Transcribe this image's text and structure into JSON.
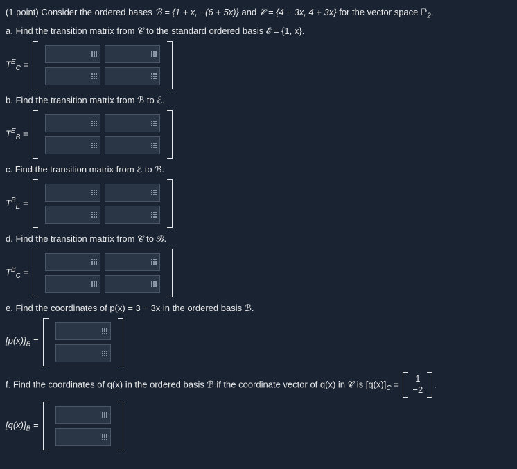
{
  "intro": {
    "points": "(1 point)",
    "text1": "Consider the ordered bases ",
    "basisB": "ℬ = {1 + x, −(6 + 5x)}",
    "text2": " and ",
    "basisC": "𝒞 = {4 − 3x, 4 + 3x}",
    "text3": " for the vector space ",
    "space": "ℙ",
    "spacesub": "2",
    "period": "."
  },
  "parts": {
    "a": {
      "label": "a. Find the transition matrix from 𝒞 to the standard ordered basis ℰ = {1, x}.",
      "lhs_T": "T",
      "lhs_sup": "E",
      "lhs_sub": "C",
      "eq": " ="
    },
    "b": {
      "label": "b. Find the transition matrix from ℬ to ℰ.",
      "lhs_T": "T",
      "lhs_sup": "E",
      "lhs_sub": "B",
      "eq": " ="
    },
    "c": {
      "label": "c. Find the transition matrix from ℰ to ℬ.",
      "lhs_T": "T",
      "lhs_sup": "B",
      "lhs_sub": "E",
      "eq": " ="
    },
    "d": {
      "label": "d. Find the transition matrix from 𝒞 to ℬ.",
      "lhs_T": "T",
      "lhs_sup": "B",
      "lhs_sub": "C",
      "eq": " ="
    },
    "e": {
      "label": "e. Find the coordinates of p(x) = 3 − 3x in the ordered basis ℬ.",
      "lhs": "[p(x)]",
      "lhs_sub": "B",
      "eq": " ="
    },
    "f": {
      "label_pre": "f. Find the coordinates of q(x) in the ordered basis ℬ if the coordinate vector of q(x) in 𝒞 is [q(x)]",
      "label_sub": "C",
      "label_eq": " = ",
      "vec_top": "1",
      "vec_bot": "−2",
      "label_end": ".",
      "lhs": "[q(x)]",
      "lhs_sub": "B",
      "eq": " ="
    }
  }
}
